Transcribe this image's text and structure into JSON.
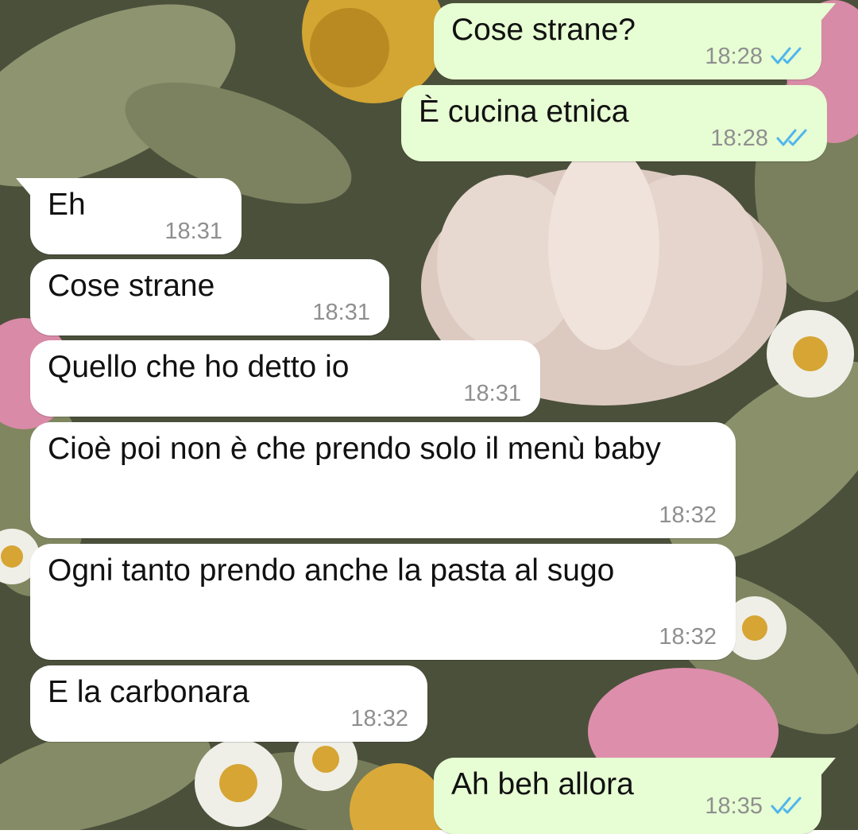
{
  "messages": [
    {
      "id": "m1",
      "direction": "outgoing",
      "text": "Cose strane?",
      "time": "18:28",
      "status": "read"
    },
    {
      "id": "m2",
      "direction": "outgoing",
      "text": "È cucina etnica",
      "time": "18:28",
      "status": "read"
    },
    {
      "id": "m3",
      "direction": "incoming",
      "text": "Eh",
      "time": "18:31"
    },
    {
      "id": "m4",
      "direction": "incoming",
      "text": "Cose strane",
      "time": "18:31"
    },
    {
      "id": "m5",
      "direction": "incoming",
      "text": "Quello che ho detto io",
      "time": "18:31"
    },
    {
      "id": "m6",
      "direction": "incoming",
      "text": "Cioè poi non è che prendo solo il menù baby",
      "time": "18:32"
    },
    {
      "id": "m7",
      "direction": "incoming",
      "text": "Ogni tanto prendo anche la pasta al sugo",
      "time": "18:32"
    },
    {
      "id": "m8",
      "direction": "incoming",
      "text": "E la carbonara",
      "time": "18:32"
    },
    {
      "id": "m9",
      "direction": "outgoing",
      "text": "Ah beh allora",
      "time": "18:35",
      "status": "read"
    }
  ],
  "colors": {
    "incoming_bubble": "#ffffff",
    "outgoing_bubble": "#e7fdd3",
    "read_ticks": "#4fb6ec",
    "timestamp": "#8f8f8f"
  },
  "icons": {
    "read_receipt": "double-check-icon"
  }
}
